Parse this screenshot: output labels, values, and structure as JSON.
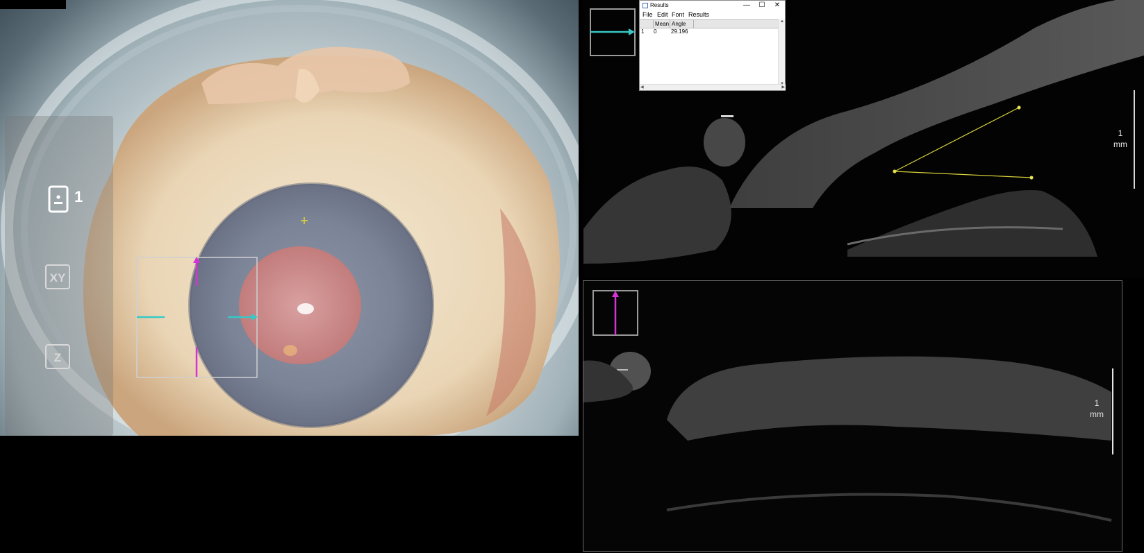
{
  "camera_view": {
    "toolbar": {
      "document_icon": "document-icon",
      "document_count": "1",
      "xy_label": "XY",
      "z_label": "Z"
    },
    "colors": {
      "horizontal_scan_marker": "#36c9c6",
      "vertical_scan_marker": "#d633d6",
      "center_crosshair": "#e8d23a"
    }
  },
  "oct_top": {
    "scale_label": "1\nmm",
    "angle_measurement_color": "#d9d23a"
  },
  "oct_bottom": {
    "scale_label": "1\nmm"
  },
  "results_window": {
    "title": "Results",
    "controls": {
      "minimize": "—",
      "maximize": "☐",
      "close": "✕"
    },
    "menu": [
      "File",
      "Edit",
      "Font",
      "Results"
    ],
    "columns": [
      "",
      "Mean",
      "Angle"
    ],
    "rows": [
      {
        "index": "1",
        "mean": "0",
        "angle": "29.196"
      }
    ]
  }
}
